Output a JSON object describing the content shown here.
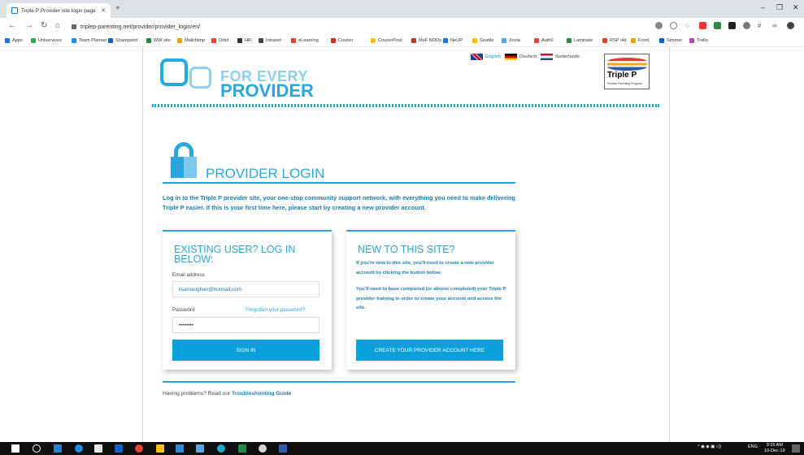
{
  "browser": {
    "tab_title": "Triple P Provider site login page",
    "url": "triplep-parenting.net/provider/provider_login/en/",
    "bookmarks": [
      "Apps",
      "Uniservices",
      "Team Planner",
      "Sharepoint",
      "WW site",
      "Mailchimp",
      "Orbit",
      "HR",
      "Intranet",
      "eLearning",
      "Courier",
      "CourierPost",
      "MoF NODs",
      "NeUP",
      "Seattle",
      "Xcela",
      "Auth0",
      "Laminate",
      "RSP old",
      "Front",
      "Simmer",
      "Trello"
    ]
  },
  "lang": {
    "english": "English",
    "deutsch": "Deutsch",
    "nederlands": "Nederlands"
  },
  "logo": {
    "line1": "FOR EVERY",
    "line2": "PROVIDER"
  },
  "triplep": {
    "name": "Triple P",
    "tagline": "Positive Parenting Program"
  },
  "page": {
    "title": "PROVIDER LOGIN",
    "intro": "Log in to the Triple P provider site, your one-stop community support network, with everything you need to make delivering Triple P easier. If this is your first time here, please start by creating a new provider account."
  },
  "login": {
    "heading": "EXISTING USER? LOG IN BELOW:",
    "email_label": "Email address",
    "email_value": "lisamaughan@hotmail.com",
    "password_label": "Password",
    "forgot": "Forgotten your password?",
    "password_value": "••••••••",
    "sign_in": "SIGN IN"
  },
  "register": {
    "heading": "NEW TO THIS SITE?",
    "text1": "If you're new to this site, you'll need to create a new provider account by clicking the button below.",
    "text2": "You'll need to have completed (or almost completed) your Triple P provider training in order to create your account and access the site.",
    "button": "CREATE YOUR PROVIDER ACCOUNT HERE"
  },
  "help": {
    "prefix": "Having problems? Read our ",
    "link": "Troubleshooting Guide"
  },
  "taskbar": {
    "lang": "ENG",
    "time": "9:15 AM",
    "date": "10-Dec-19"
  }
}
